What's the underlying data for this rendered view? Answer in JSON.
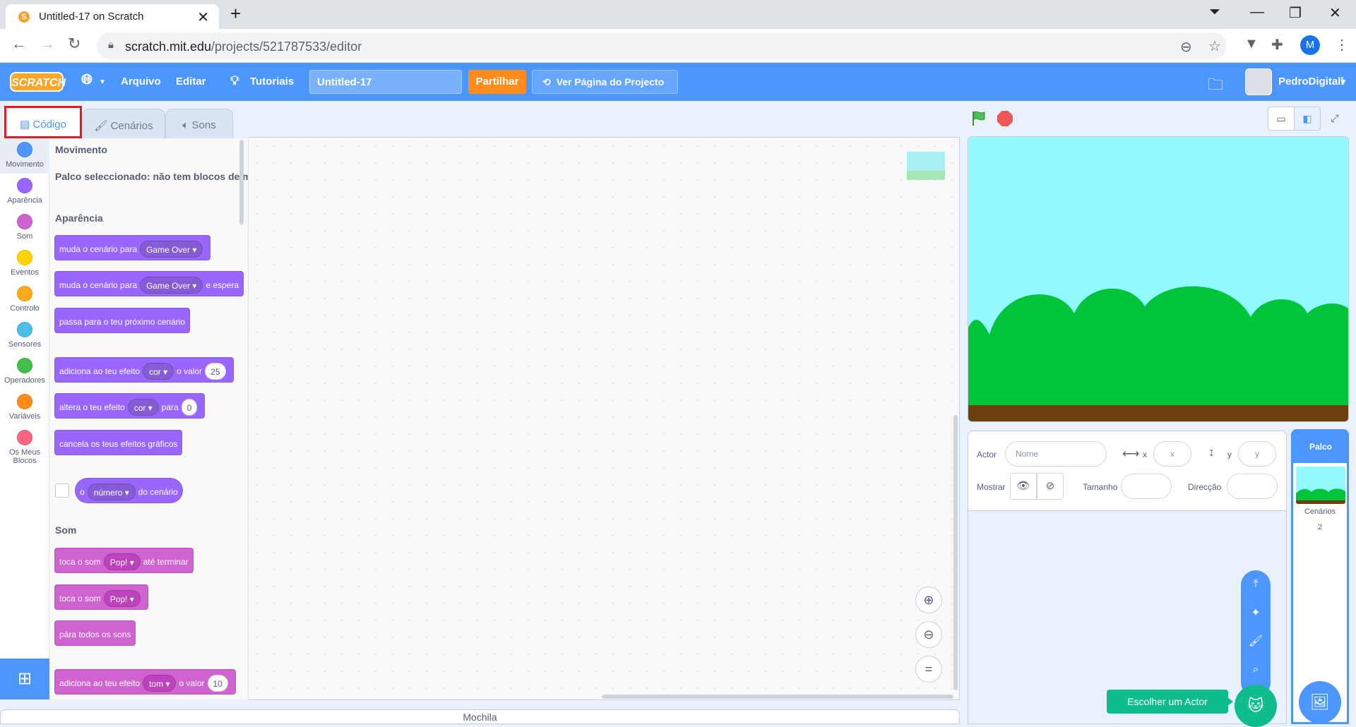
{
  "browser": {
    "tab_title": "Untitled-17 on Scratch",
    "url_host": "scratch.mit.edu",
    "url_path": "/projects/521787533/editor",
    "profile_initial": "M"
  },
  "menubar": {
    "logo": "SCRATCH",
    "file": "Arquivo",
    "edit": "Editar",
    "tutorials": "Tutoriais",
    "project_name": "Untitled-17",
    "share": "Partilhar",
    "see_project": "Ver Página do Projecto",
    "username": "PedroDigitall"
  },
  "editor_tabs": {
    "code": "Código",
    "costumes": "Cenários",
    "sounds": "Sons"
  },
  "categories": [
    {
      "label": "Movimento",
      "color": "#4c97ff"
    },
    {
      "label": "Aparência",
      "color": "#9966ff"
    },
    {
      "label": "Som",
      "color": "#cf63cf"
    },
    {
      "label": "Eventos",
      "color": "#ffd500"
    },
    {
      "label": "Controlo",
      "color": "#ffab19"
    },
    {
      "label": "Sensores",
      "color": "#4cbfe6"
    },
    {
      "label": "Operadores",
      "color": "#40bf4a"
    },
    {
      "label": "Variáveis",
      "color": "#ff8c1a"
    },
    {
      "label": "Os Meus",
      "label2": "Blocos",
      "color": "#ff6680"
    }
  ],
  "palette": {
    "movement_heading": "Movimento",
    "movement_note": "Palco seleccionado: não tem blocos de movimento",
    "looks_heading": "Aparência",
    "sound_heading": "Som",
    "blocks": {
      "switch_backdrop": {
        "text": "muda o cenário para",
        "value": "Game Over"
      },
      "switch_backdrop_wait": {
        "text": "muda o cenário para",
        "value": "Game Over",
        "suffix": "e espera"
      },
      "next_backdrop": {
        "text": "passa para o teu próximo cenário"
      },
      "change_effect": {
        "text": "adiciona ao teu efeito",
        "value": "cor",
        "mid": "o valor",
        "num": "25"
      },
      "set_effect": {
        "text": "altera o teu efeito",
        "value": "cor",
        "mid": "para",
        "num": "0"
      },
      "clear_effects": {
        "text": "cancela os teus efeitos gráficos"
      },
      "backdrop_reporter": {
        "prefix": "o",
        "value": "número",
        "suffix": "do cenário"
      },
      "play_until_done": {
        "text": "toca o som",
        "value": "Pop!",
        "suffix": "até terminar"
      },
      "start_sound": {
        "text": "toca o som",
        "value": "Pop!"
      },
      "stop_sounds": {
        "text": "pára todos os sons"
      },
      "change_sound_effect": {
        "text": "adiciona ao teu efeito",
        "value": "tom",
        "mid": "o valor",
        "num": "10"
      }
    }
  },
  "backpack": "Mochila",
  "sprite_info": {
    "sprite_label": "Actor",
    "name_placeholder": "Nome",
    "x_label": "x",
    "x_placeholder": "x",
    "y_label": "y",
    "y_placeholder": "y",
    "show_label": "Mostrar",
    "size_label": "Tamanho",
    "direction_label": "Direcção"
  },
  "stage_panel": {
    "title": "Palco",
    "backdrops_label": "Cenários",
    "backdrops_count": "2"
  },
  "choose_sprite": "Escolher um Actor",
  "colors": {
    "scratch_blue": "#4c97ff",
    "share_orange": "#ff8c1a",
    "looks_purple": "#9966ff",
    "sound_pink": "#cf63cf",
    "sky": "#93fbff",
    "hills": "#00c53a",
    "ground": "#6b3f0e",
    "highlight_red": "#e51b23"
  }
}
